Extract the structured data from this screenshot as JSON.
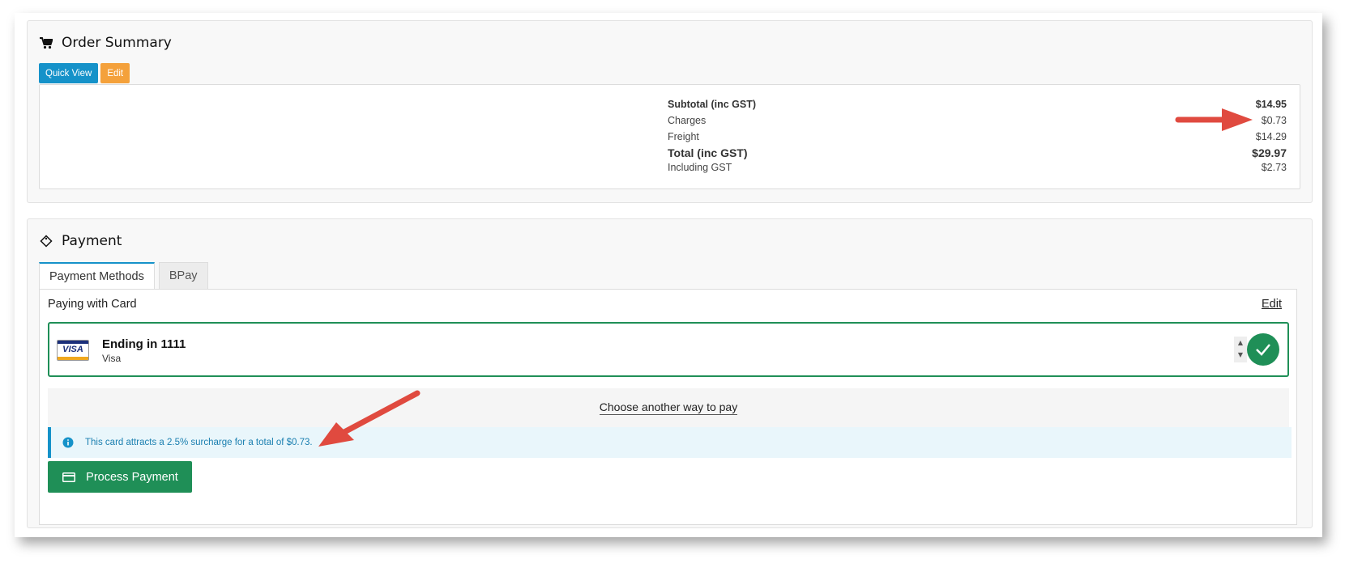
{
  "order_summary": {
    "title": "Order Summary",
    "icon": "cart-icon",
    "quick_view_label": "Quick View",
    "edit_label": "Edit",
    "rows": [
      {
        "label": "Subtotal (inc GST)",
        "value": "$14.95"
      },
      {
        "label": "Charges",
        "value": "$0.73"
      },
      {
        "label": "Freight",
        "value": "$14.29"
      },
      {
        "label": "Total (inc GST)",
        "value": "$29.97"
      },
      {
        "label": "Including GST",
        "value": "$2.73"
      }
    ]
  },
  "payment": {
    "title": "Payment",
    "icon": "tag-icon",
    "tabs": [
      {
        "label": "Payment Methods",
        "active": true
      },
      {
        "label": "BPay",
        "active": false
      }
    ],
    "paying_label": "Paying with Card",
    "edit_label": "Edit",
    "card": {
      "brand_logo": "VISA",
      "title": "Ending in 1111",
      "subtitle": "Visa"
    },
    "another_way_label": "Choose another way to pay",
    "surcharge_notice": "This card attracts a 2.5% surcharge for a total of $0.73.",
    "process_button_label": "Process Payment"
  },
  "colors": {
    "primary_blue": "#1592c9",
    "edit_orange": "#f4a13b",
    "success_green": "#1f8f57",
    "annotation_red": "#e04a3f"
  }
}
